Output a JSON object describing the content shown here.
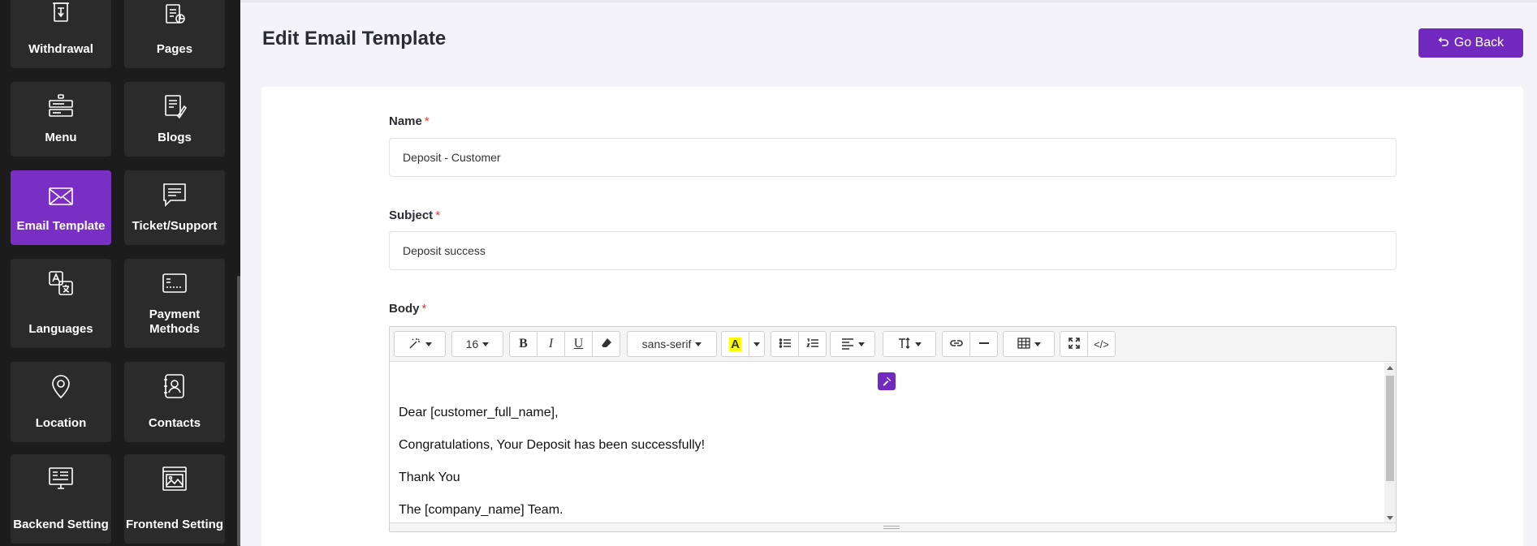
{
  "sidebar": {
    "tiles": [
      {
        "label": "Withdrawal",
        "icon": "atm-withdrawal-icon"
      },
      {
        "label": "Pages",
        "icon": "pages-icon"
      },
      {
        "label": "Menu",
        "icon": "menu-icon"
      },
      {
        "label": "Blogs",
        "icon": "blogs-icon"
      },
      {
        "label": "Email Template",
        "icon": "envelope-icon",
        "active": true
      },
      {
        "label": "Ticket/Support",
        "icon": "chat-icon"
      },
      {
        "label": "Languages",
        "icon": "translate-icon"
      },
      {
        "label": "Payment Methods",
        "icon": "card-icon"
      },
      {
        "label": "Location",
        "icon": "map-pin-icon"
      },
      {
        "label": "Contacts",
        "icon": "contacts-icon"
      },
      {
        "label": "Backend Setting",
        "icon": "backend-monitor-icon"
      },
      {
        "label": "Frontend Setting",
        "icon": "frontend-image-icon"
      }
    ]
  },
  "header": {
    "title": "Edit Email Template",
    "go_back_label": "Go Back"
  },
  "form": {
    "name": {
      "label": "Name",
      "required_mark": "*",
      "value": "Deposit - Customer"
    },
    "subject": {
      "label": "Subject",
      "required_mark": "*",
      "value": "Deposit success"
    },
    "body": {
      "label": "Body",
      "required_mark": "*"
    }
  },
  "editor": {
    "toolbar": {
      "font_size": "16",
      "font_family": "sans-serif",
      "highlight_letter": "A",
      "code_view": "</>"
    },
    "content": [
      "Dear [customer_full_name],",
      "Congratulations, Your Deposit has been successfully!",
      "Thank You",
      "The [company_name] Team."
    ]
  },
  "colors": {
    "accent": "#7229c0",
    "sidebar_bg": "#1c1c1c",
    "tile_bg": "#2b2b2b",
    "required": "#e23b3b"
  }
}
